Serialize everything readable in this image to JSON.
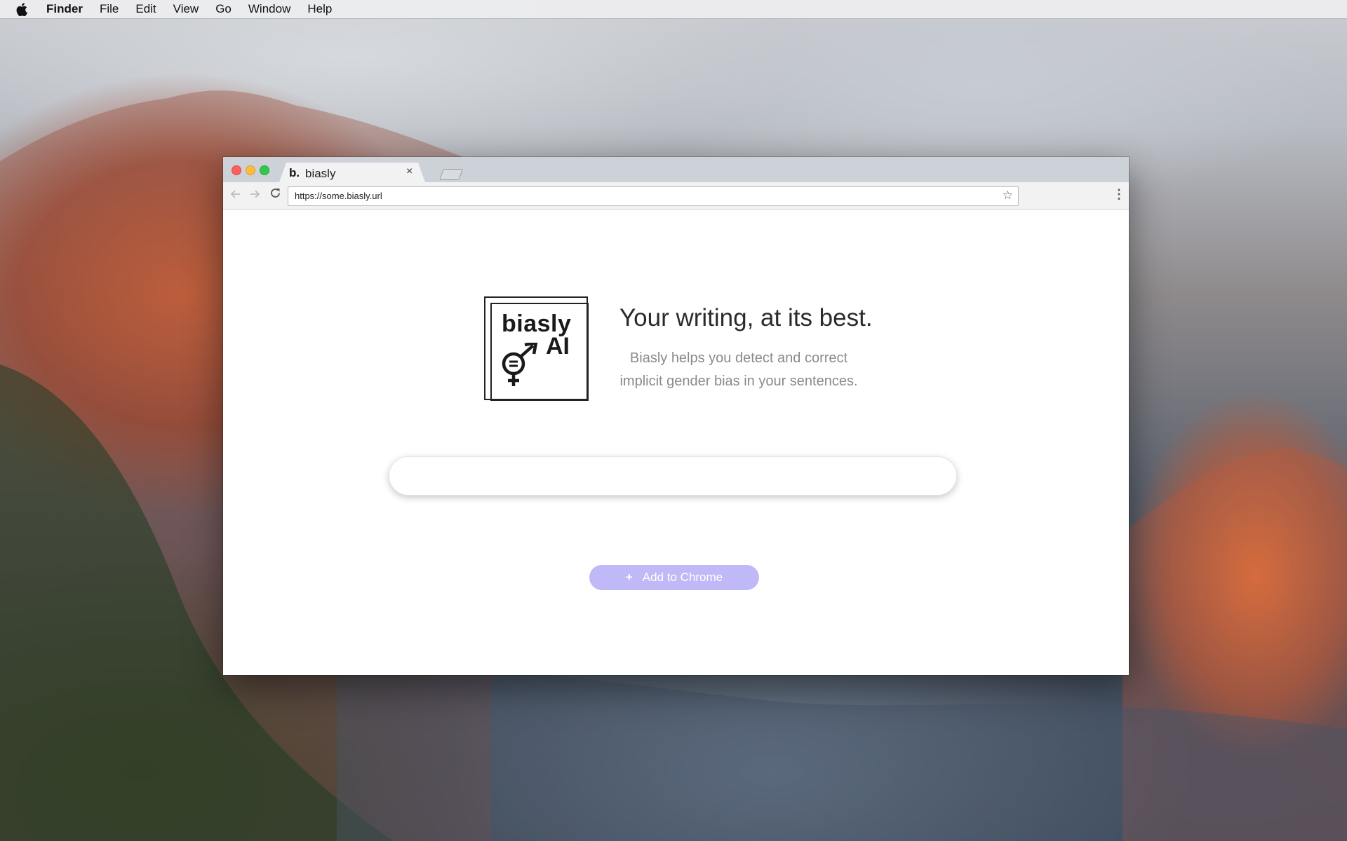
{
  "menubar": {
    "app_name": "Finder",
    "items": [
      "File",
      "Edit",
      "View",
      "Go",
      "Window",
      "Help"
    ]
  },
  "browser": {
    "tab": {
      "favicon_text": "b.",
      "title": "biasly",
      "close_glyph": "×"
    },
    "address_bar": {
      "url": "https://some.biasly.url"
    },
    "icons": {
      "back": "back-arrow-icon",
      "forward": "forward-arrow-icon",
      "reload": "reload-icon",
      "bookmark": "star-icon",
      "menu": "kebab-menu-icon"
    }
  },
  "page": {
    "logo": {
      "line1": "biasly",
      "line2": "AI"
    },
    "headline": "Your writing, at its best.",
    "subheadline_line1": "Biasly helps you detect and correct",
    "subheadline_line2": "implicit gender bias in your sentences.",
    "text_input": {
      "value": "",
      "placeholder": ""
    },
    "cta": {
      "icon": "+",
      "label": "Add to Chrome"
    }
  },
  "colors": {
    "accent_button": "#c0b9f7",
    "traffic_close": "#fc605c",
    "traffic_minimize": "#fdbc40",
    "traffic_maximize": "#34c84a"
  }
}
